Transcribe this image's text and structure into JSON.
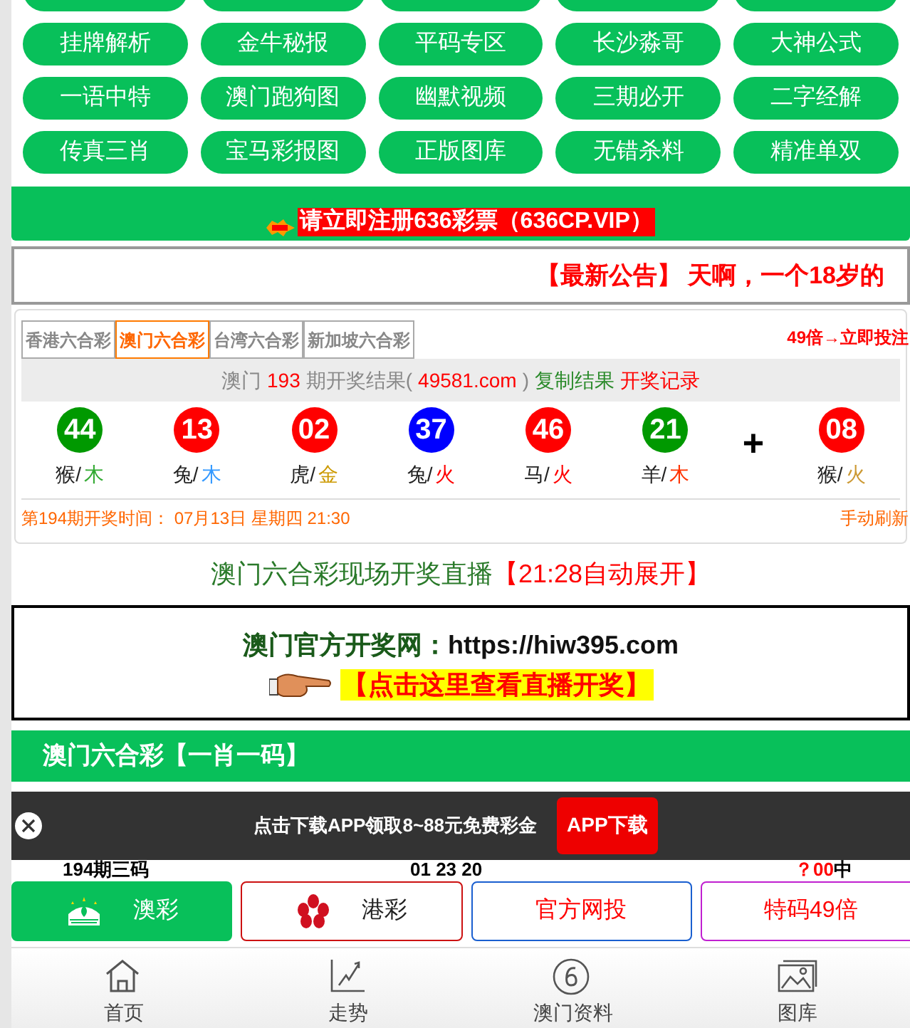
{
  "menu": [
    "挂牌解析",
    "金牛秘报",
    "平码专区",
    "长沙淼哥",
    "大神公式",
    "一语中特",
    "澳门跑狗图",
    "幽默视频",
    "三期必开",
    "二字经解",
    "传真三肖",
    "宝马彩报图",
    "正版图库",
    "无错杀料",
    "精准单双"
  ],
  "promo": {
    "text": "请立即注册636彩票（636CP.VIP）"
  },
  "notice": "【最新公告】 天啊，一个18岁的",
  "tabs": [
    {
      "label": "香港六合彩",
      "selected": false
    },
    {
      "label": "澳门六合彩",
      "selected": true
    },
    {
      "label": "台湾六合彩",
      "selected": false
    },
    {
      "label": "新加坡六合彩",
      "selected": false
    }
  ],
  "bet_link": "49倍→立即投注",
  "result_header": [
    {
      "text": "澳门",
      "kind": "plain"
    },
    {
      "text": "193",
      "kind": "highlight"
    },
    {
      "text": "期开奖结果(",
      "kind": "plain"
    },
    {
      "text": "49581.com",
      "kind": "highlight"
    },
    {
      "text": ")",
      "kind": "plain"
    },
    {
      "text": "复制结果",
      "kind": "copy"
    },
    {
      "text": "开奖记录",
      "kind": "record"
    }
  ],
  "balls": [
    {
      "number": "44",
      "color": "#009900",
      "zodiac": "猴/",
      "element": {
        "text": "木",
        "color": "#33aa33"
      }
    },
    {
      "number": "13",
      "color": "#ff0000",
      "zodiac": "兔/",
      "element": {
        "text": "木",
        "color": "#3399ff"
      }
    },
    {
      "number": "02",
      "color": "#ff0000",
      "zodiac": "虎/",
      "element": {
        "text": "金",
        "color": "#cc9900"
      }
    },
    {
      "number": "37",
      "color": "#0000ff",
      "zodiac": "兔/",
      "element": {
        "text": "火",
        "color": "#ff0000"
      }
    },
    {
      "number": "46",
      "color": "#ff0000",
      "zodiac": "马/",
      "element": {
        "text": "火",
        "color": "#ff0000"
      }
    },
    {
      "number": "21",
      "color": "#009900",
      "zodiac": "羊/",
      "element": {
        "text": "木",
        "color": "#ff3300"
      }
    }
  ],
  "plus": "+",
  "special_ball": {
    "number": "08",
    "color": "#ff0000",
    "zodiac": "猴/",
    "element": {
      "text": "火",
      "color": "#cc9933"
    }
  },
  "next_draw": "第194期开奖时间： 07月13日 星期四 21:30",
  "refresh": "手动刷新",
  "live": {
    "title": "澳门六合彩现场开奖直播",
    "note": "【21:28自动展开】"
  },
  "official": {
    "label": "澳门官方开奖网：",
    "url": "https://hiw395.com",
    "cta": "【点击这里查看直播开奖】"
  },
  "section_title": "澳门六合彩【一肖一码】",
  "app_bar": {
    "text": "点击下载APP领取8~88元免费彩金",
    "button": "APP下载"
  },
  "row": {
    "issue": "194期三码",
    "numbers": "01 23 20",
    "result_mark": "？00",
    "result": "中"
  },
  "float_buttons": [
    {
      "label": "澳彩",
      "kind": "macau"
    },
    {
      "label": "港彩",
      "kind": "hongkong"
    },
    {
      "label": "官方网投",
      "kind": "blue"
    },
    {
      "label": "特码49倍",
      "kind": "purple"
    }
  ],
  "nav": [
    {
      "label": "首页",
      "kind": "home"
    },
    {
      "label": "走势",
      "kind": "trend"
    },
    {
      "label": "澳门资料",
      "kind": "six"
    },
    {
      "label": "图库",
      "kind": "gallery"
    }
  ]
}
